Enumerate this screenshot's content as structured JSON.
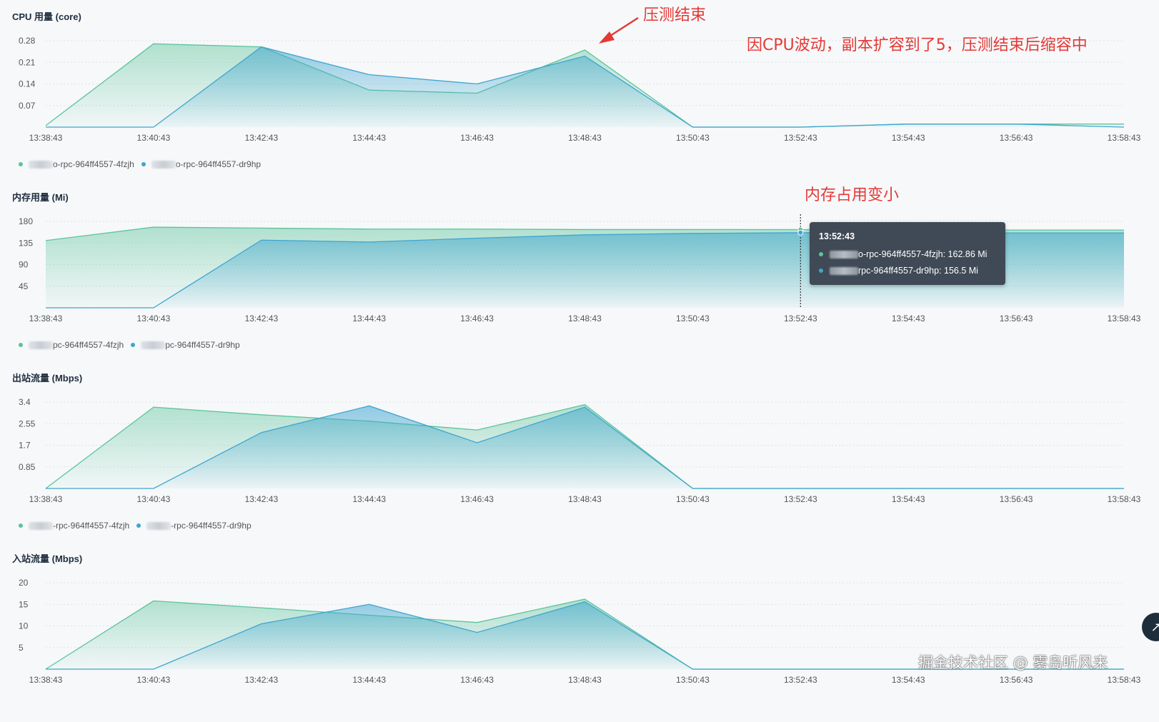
{
  "x_labels": [
    "13:38:43",
    "13:40:43",
    "13:42:43",
    "13:44:43",
    "13:46:43",
    "13:48:43",
    "13:50:43",
    "13:52:43",
    "13:54:43",
    "13:56:43",
    "13:58:43"
  ],
  "colors": {
    "series_a": "#5cc49a",
    "series_b": "#3fa5cf",
    "annotation": "#e53935"
  },
  "panels": [
    {
      "title": "CPU 用量 (core)",
      "legend": [
        "o-rpc-964ff4557-4fzjh",
        "o-rpc-964ff4557-dr9hp"
      ]
    },
    {
      "title": "内存用量 (Mi)",
      "legend": [
        "pc-964ff4557-4fzjh",
        "pc-964ff4557-dr9hp"
      ]
    },
    {
      "title": "出站流量 (Mbps)",
      "legend": [
        "-rpc-964ff4557-4fzjh",
        "-rpc-964ff4557-dr9hp"
      ]
    },
    {
      "title": "入站流量 (Mbps)",
      "legend": []
    }
  ],
  "annotations": {
    "stress_end": "压测结束",
    "cpu_note": "因CPU波动，副本扩容到了5，压测结束后缩容中",
    "memory_note": "内存占用变小"
  },
  "tooltip": {
    "time": "13:52:43",
    "row_a": "o-rpc-964ff4557-4fzjh: 162.86 Mi",
    "row_b": "rpc-964ff4557-dr9hp: 156.5 Mi"
  },
  "watermark": "掘金技术社区 @ 雾岛听风来",
  "chart_data": [
    {
      "type": "area",
      "title": "CPU 用量 (core)",
      "x": [
        "13:38:43",
        "13:40:43",
        "13:42:43",
        "13:44:43",
        "13:46:43",
        "13:48:43",
        "13:50:43",
        "13:52:43",
        "13:54:43",
        "13:56:43",
        "13:58:43"
      ],
      "y_ticks": [
        0.07,
        0.14,
        0.21,
        0.28
      ],
      "ylim": [
        0,
        0.28
      ],
      "series": [
        {
          "name": "o-rpc-964ff4557-4fzjh",
          "values": [
            0.005,
            0.27,
            0.26,
            0.12,
            0.11,
            0.25,
            0.0,
            0.0,
            0.01,
            0.01,
            0.01
          ]
        },
        {
          "name": "o-rpc-964ff4557-dr9hp",
          "values": [
            0.0,
            0.0,
            0.26,
            0.17,
            0.14,
            0.23,
            0.0,
            0.0,
            0.01,
            0.01,
            0.0
          ]
        }
      ]
    },
    {
      "type": "area",
      "title": "内存用量 (Mi)",
      "x": [
        "13:38:43",
        "13:40:43",
        "13:42:43",
        "13:44:43",
        "13:46:43",
        "13:48:43",
        "13:50:43",
        "13:52:43",
        "13:54:43",
        "13:56:43",
        "13:58:43"
      ],
      "y_ticks": [
        45,
        90,
        135,
        180
      ],
      "ylim": [
        0,
        180
      ],
      "series": [
        {
          "name": "pc-964ff4557-4fzjh",
          "values": [
            140,
            168,
            166,
            164,
            164,
            163,
            163,
            162.86,
            162,
            162,
            162
          ]
        },
        {
          "name": "pc-964ff4557-dr9hp",
          "values": [
            0,
            0,
            141,
            137,
            145,
            152,
            155,
            156.5,
            156,
            156,
            156
          ]
        }
      ]
    },
    {
      "type": "area",
      "title": "出站流量 (Mbps)",
      "x": [
        "13:38:43",
        "13:40:43",
        "13:42:43",
        "13:44:43",
        "13:46:43",
        "13:48:43",
        "13:50:43",
        "13:52:43",
        "13:54:43",
        "13:56:43",
        "13:58:43"
      ],
      "y_ticks": [
        0.85,
        1.7,
        2.55,
        3.4
      ],
      "ylim": [
        0,
        3.4
      ],
      "series": [
        {
          "name": "-rpc-964ff4557-4fzjh",
          "values": [
            0.0,
            3.2,
            2.9,
            2.65,
            2.3,
            3.3,
            0.0,
            0.0,
            0.0,
            0.0,
            0.0
          ]
        },
        {
          "name": "-rpc-964ff4557-dr9hp",
          "values": [
            0.0,
            0.0,
            2.2,
            3.25,
            1.8,
            3.2,
            0.0,
            0.0,
            0.0,
            0.0,
            0.0
          ]
        }
      ]
    },
    {
      "type": "area",
      "title": "入站流量 (Mbps)",
      "x": [
        "13:38:43",
        "13:40:43",
        "13:42:43",
        "13:44:43",
        "13:46:43",
        "13:48:43",
        "13:50:43",
        "13:52:43",
        "13:54:43",
        "13:56:43",
        "13:58:43"
      ],
      "y_ticks": [
        5,
        10,
        15,
        20
      ],
      "ylim": [
        0,
        20
      ],
      "series": [
        {
          "values": [
            0.0,
            15.8,
            14.2,
            12.5,
            10.8,
            16.2,
            0.0,
            0.0,
            0.0,
            0.0,
            0.0
          ]
        },
        {
          "values": [
            0.0,
            0.0,
            10.5,
            15.0,
            8.5,
            15.6,
            0.0,
            0.0,
            0.0,
            0.0,
            0.0
          ]
        }
      ]
    }
  ]
}
